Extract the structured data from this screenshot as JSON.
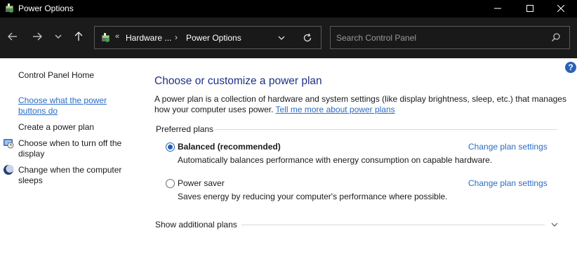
{
  "window": {
    "title": "Power Options",
    "app_icon": "power-options-icon",
    "controls": [
      "minimize-icon",
      "maximize-icon",
      "close-icon"
    ]
  },
  "navigation": {
    "buttons": [
      "back-arrow-icon",
      "forward-arrow-icon",
      "recent-locations-icon",
      "up-arrow-icon"
    ],
    "address": {
      "icon": "control-panel-icon",
      "overflow": "«",
      "crumbs": [
        "Hardware ...",
        "Power Options"
      ],
      "separator": "›"
    },
    "search": {
      "placeholder": "Search Control Panel",
      "value": ""
    }
  },
  "sidebar": {
    "items": [
      {
        "label": "Control Panel Home"
      },
      {
        "label": "Choose what the power buttons do"
      },
      {
        "label": "Create a power plan"
      },
      {
        "label": "Choose when to turn off the display",
        "icon": "display-power-icon"
      },
      {
        "label": "Change when the computer sleeps",
        "icon": "sleep-moon-icon"
      }
    ]
  },
  "main": {
    "title": "Choose or customize a power plan",
    "description": "A power plan is a collection of hardware and system settings (like display brightness, sleep, etc.) that manages how your computer uses power.",
    "learn_more": "Tell me more about power plans",
    "preferred_label": "Preferred plans",
    "plans": [
      {
        "name": "Balanced (recommended)",
        "description": "Automatically balances performance with energy consumption on capable hardware.",
        "link": "Change plan settings",
        "selected": true
      },
      {
        "name": "Power saver",
        "description": "Saves energy by reducing your computer's performance where possible.",
        "link": "Change plan settings",
        "selected": false
      }
    ],
    "additional_label": "Show additional plans"
  },
  "colors": {
    "title_bar": "#000000",
    "nav_bar": "#1b1b1b",
    "heading": "#1e3287",
    "link": "#2b6cc4",
    "radio_selected": "#1f5fb8"
  }
}
